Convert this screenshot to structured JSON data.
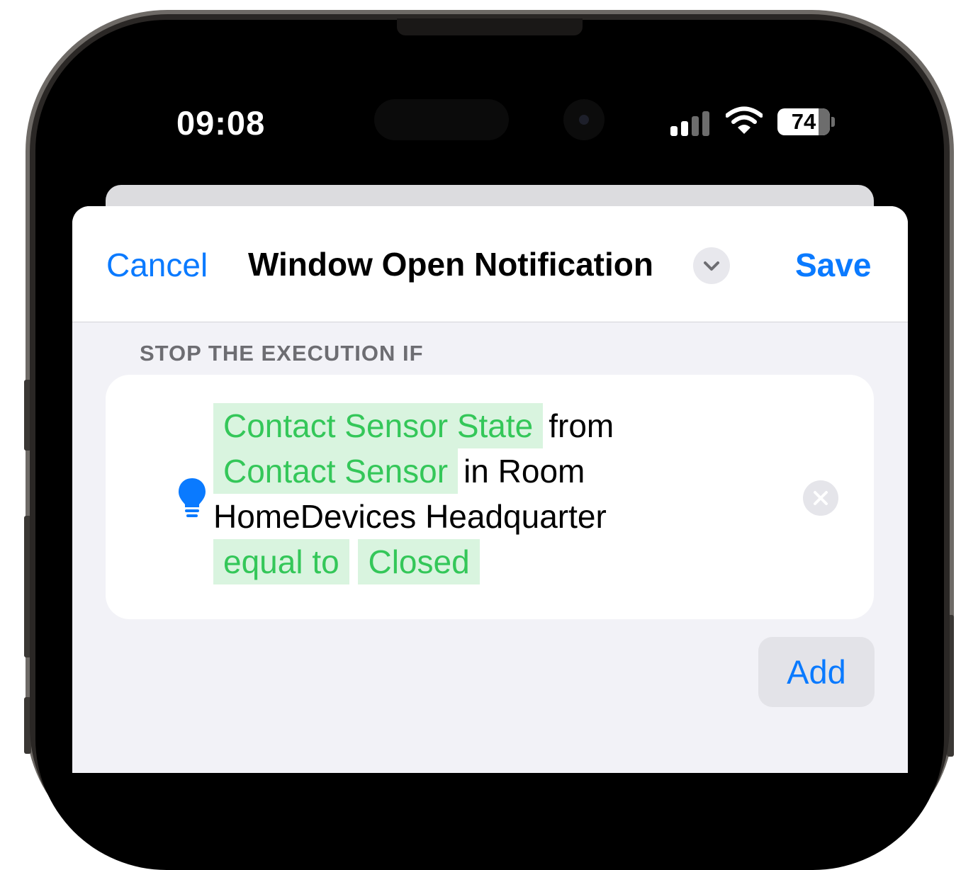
{
  "status_bar": {
    "time": "09:08",
    "battery_level": "74",
    "signal_bars_active": 2,
    "signal_bars_total": 4
  },
  "nav": {
    "cancel_label": "Cancel",
    "title": "Window Open Notification",
    "save_label": "Save"
  },
  "section": {
    "header": "STOP THE EXECUTION IF"
  },
  "condition": {
    "token_state": "Contact Sensor State",
    "word_from": "from",
    "token_device": "Contact Sensor",
    "word_in_room": "in Room",
    "room_name": "HomeDevices Headquarter",
    "token_operator": "equal to",
    "token_value": "Closed",
    "icon": "lightbulb-icon"
  },
  "add_label": "Add",
  "colors": {
    "accent": "#0A7AFF",
    "token_text": "#34C759",
    "token_background": "#D9F4DF",
    "sheet_background": "#F2F2F7"
  }
}
